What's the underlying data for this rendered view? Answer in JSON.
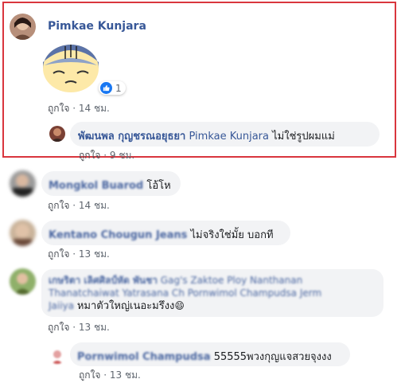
{
  "top_comment": {
    "author": "Pimkae Kunjara",
    "reaction_count": "1",
    "like_label": "ถูกใจ",
    "time": "14 ชม.",
    "sticker": "sad-face-sticker"
  },
  "reply": {
    "author": "พัฒนพล กุญชรณอยุธยา",
    "mention": "Pimkae Kunjara",
    "text": "ไม่ใช่รูปผมแม่",
    "like_label": "ถูกใจ",
    "time": "9 ชม."
  },
  "comments": [
    {
      "author": "Mongkol Buarod",
      "text": "โอ้โห",
      "like_label": "ถูกใจ",
      "time": "14 ชม."
    },
    {
      "author": "Kentano Chougun Jeans",
      "text": "ไม่จริงใช่มั้ย บอกที",
      "like_label": "ถูกใจ",
      "time": "13 ชม."
    },
    {
      "author": "เกษริตา เลิศศิลป์หัด พันชา",
      "tags_line1": "Gag's Zaktoe Ploy Nanthanan",
      "tags_line2": "Thanatchaiwat Yatrasana Ch Pornwimol Champudsa Jerm",
      "tags_line3": "Jaiiya",
      "text": "หมาตัวใหญ่เนอะมรึงง",
      "emoji": "😄",
      "like_label": "ถูกใจ",
      "time": "13 ชม."
    }
  ],
  "last_reply": {
    "author": "Pornwimol Champudsa",
    "text": "55555พวงกุญแจสวยจุงงง",
    "like_label": "ถูกใจ",
    "time": "13 ชม."
  },
  "colors": {
    "name": "#385898",
    "highlight": "#d9363e",
    "bubble": "#f2f3f5",
    "like_blue": "#1877f2"
  }
}
